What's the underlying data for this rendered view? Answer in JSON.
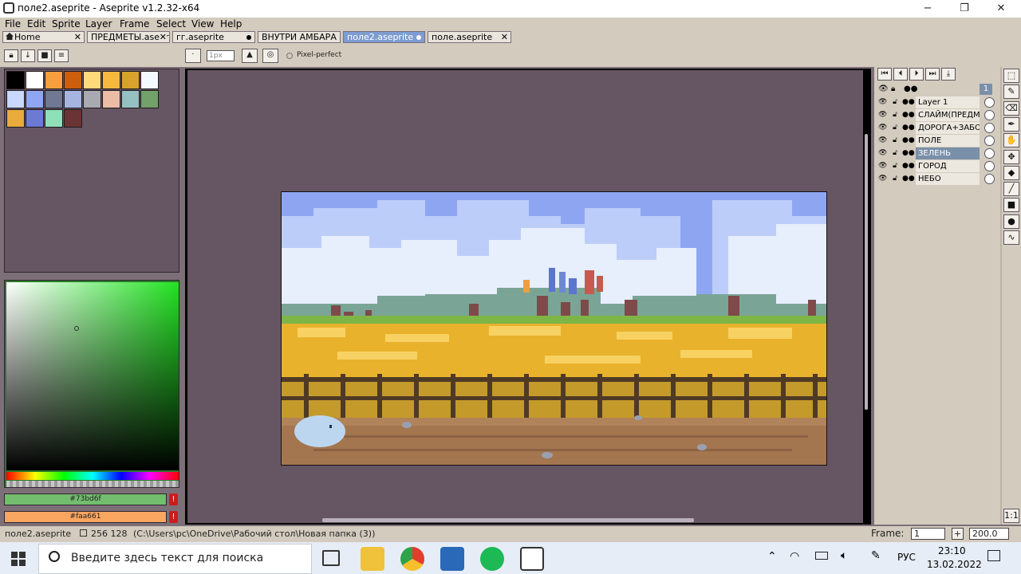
{
  "window": {
    "title": "поле2.aseprite - Aseprite v1.2.32-x64",
    "controls": [
      "−",
      "❐",
      "✕"
    ]
  },
  "menu": [
    "File",
    "Edit",
    "Sprite",
    "Layer",
    "Frame",
    "Select",
    "View",
    "Help"
  ],
  "tabs": [
    {
      "label": "Home",
      "state": "close"
    },
    {
      "label": "ПРЕДМЕТЫ.aseprite",
      "state": "close"
    },
    {
      "label": "гг.aseprite",
      "state": "modified"
    },
    {
      "label": "ВНУТРИ АМБАРА",
      "state": "none"
    },
    {
      "label": "поле2.aseprite",
      "state": "modified",
      "active": true
    },
    {
      "label": "поле.aseprite",
      "state": "close"
    }
  ],
  "toolbar": {
    "brush_size": "1px",
    "pixel_perfect_label": "Pixel-perfect"
  },
  "palette": {
    "colors": [
      "#000000",
      "#ffffff",
      "#f5a03c",
      "#cc5e0e",
      "#ffd97a",
      "#f6b940",
      "#d7a32c",
      "#f4f8ff",
      "#c9d8ff",
      "#8fa7f2",
      "#707894",
      "#a5b5df",
      "#a9a9b1",
      "#ecbca4",
      "#95c2c0",
      "#73a16a",
      "#e8ab3c",
      "#6d7ad4",
      "#8fe0b8",
      "#6b3434"
    ]
  },
  "colors": {
    "foreground": "#73bd6f",
    "background": "#faa661"
  },
  "timeline": {
    "buttons": [
      "⏮",
      "⏴",
      "⏵",
      "⏭",
      "⤓"
    ],
    "frame_number": "1",
    "layers": [
      {
        "name": "Layer 1",
        "selected": false
      },
      {
        "name": "СЛАЙМ(ПРЕДМЕТ)",
        "selected": false
      },
      {
        "name": "ДОРОГА+ЗАБОР",
        "selected": false
      },
      {
        "name": "ПОЛЕ",
        "selected": false
      },
      {
        "name": "ЗЕЛЕНЬ",
        "selected": true
      },
      {
        "name": "ГОРОД",
        "selected": false
      },
      {
        "name": "НЕБО",
        "selected": false
      }
    ]
  },
  "tools": [
    "marquee-icon",
    "pencil-icon",
    "eraser-icon",
    "eyedropper-icon",
    "hand-icon",
    "move-icon",
    "fill-icon",
    "line-icon",
    "rectangle-icon",
    "blob-icon",
    "blur-icon"
  ],
  "status": {
    "file": "поле2.aseprite",
    "size": "256 128",
    "path": "(C:\\Users\\pc\\OneDrive\\Рабочий стол\\Новая папка (3))",
    "frame_label": "Frame:",
    "frame_value": "1",
    "zoom": "200.0"
  },
  "taskbar": {
    "search_placeholder": "Введите здесь текст для поиска",
    "lang": "РУС",
    "time": "23:10",
    "date": "13.02.2022"
  }
}
